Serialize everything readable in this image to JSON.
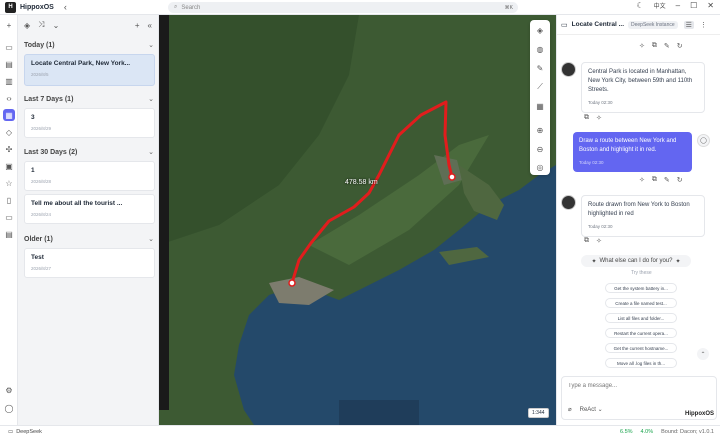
{
  "app": {
    "name": "HippoxOS",
    "search_placeholder": "Search",
    "search_shortcut": "⌘K",
    "lang": "中文"
  },
  "sidebar": {
    "groups": [
      {
        "label": "Today (1)",
        "items": [
          {
            "title": "Locate Central Park, New York...",
            "date": "2026/8/5",
            "selected": true
          }
        ]
      },
      {
        "label": "Last 7 Days (1)",
        "items": [
          {
            "title": "3",
            "date": "2026/8/29"
          }
        ]
      },
      {
        "label": "Last 30 Days (2)",
        "items": [
          {
            "title": "1",
            "date": "2026/8/28"
          },
          {
            "title": "Tell me about all the tourist ...",
            "date": "2026/8/24"
          }
        ]
      },
      {
        "label": "Older (1)",
        "items": [
          {
            "title": "Test",
            "date": "2026/8/27"
          }
        ]
      }
    ]
  },
  "map": {
    "distance_label": "478.58 km",
    "scale_label": "1:344"
  },
  "chat": {
    "title": "Locate Central ...",
    "model": "DeepSeek Instance",
    "messages": [
      {
        "role": "assistant",
        "text": "Central Park is located in Manhattan, New York City, between 59th and 110th Streets.",
        "time": "Today 02:30"
      },
      {
        "role": "user",
        "text": "Draw a route between New York and Boston and highlight it in red.",
        "time": "Today 02:30"
      },
      {
        "role": "assistant",
        "text": "Route drawn from New York to Boston highlighted in red",
        "time": "Today 02:30"
      }
    ],
    "suggest_title": "What else can I do for you?",
    "try_these": "Try these",
    "suggestions": [
      "Get the system battery in...",
      "Create a file named test...",
      "List all files and folder...",
      "Restart the current opera...",
      "Get the current hostname...",
      "Move all .log files in th..."
    ],
    "composer_placeholder": "Type a message...",
    "mode": "ReAct",
    "brand": "HippoxOS"
  },
  "status": {
    "model": "DeepSeek",
    "cpu": "6.5%",
    "mem": "4.0%",
    "extra": "Bound: Dacon; v1.0.1"
  },
  "colors": {
    "accent": "#6366f1",
    "route": "#e11d1d"
  }
}
